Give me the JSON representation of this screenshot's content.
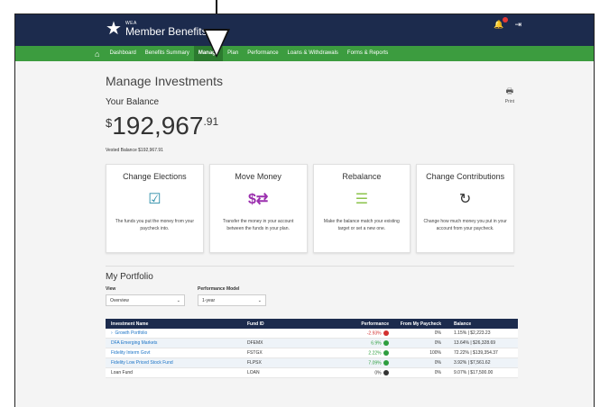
{
  "header": {
    "logo_small": "WEA",
    "logo_big": "Member Benefits",
    "bell_icon": "bell-icon",
    "logout_icon": "logout-icon"
  },
  "nav": {
    "items": [
      "Dashboard",
      "Benefits Summary",
      "Manage",
      "Plan",
      "Performance",
      "Loans & Withdrawals",
      "Forms & Reports"
    ],
    "active": "Manage"
  },
  "page": {
    "title": "Manage Investments",
    "print_label": "Print",
    "balance_label": "Your Balance",
    "balance_dollar": "$",
    "balance_main": "192,967",
    "balance_cents": ".91",
    "vested": "Vested Balance $192,967.91"
  },
  "cards": [
    {
      "title": "Change Elections",
      "icon": "✅",
      "desc": "The funds you put the money from your paycheck into.",
      "color": "#2a8ca8"
    },
    {
      "title": "Move Money",
      "icon": "$⇄",
      "desc": "Transfer the money in your account between the funds in your plan.",
      "color": "#9b2fae"
    },
    {
      "title": "Rebalance",
      "icon": "☰",
      "desc": "Make the balance match your existing target or set a new one.",
      "color": "#8bc34a"
    },
    {
      "title": "Change Contributions",
      "icon": "↻",
      "desc": "Change how much money you put in your account from your paycheck.",
      "color": "#333333"
    }
  ],
  "portfolio": {
    "title": "My Portfolio",
    "view_label": "View",
    "view_value": "Overview",
    "model_label": "Performance Model",
    "model_value": "1-year",
    "columns": [
      "Investment Name",
      "Fund ID",
      "Performance",
      "From My Paycheck",
      "Balance"
    ],
    "rows": [
      {
        "name": "Growth Portfolio",
        "fund": "",
        "perf": "-2.93%",
        "paycheck": "0%",
        "balance": "1.15%  |  $2,223.23"
      },
      {
        "name": "DFA Emerging Markets",
        "fund": "DFEMX",
        "perf": "6.9%",
        "paycheck": "0%",
        "balance": "13.64%  |  $26,328.69"
      },
      {
        "name": "Fidelity Interm Govt",
        "fund": "FSTGX",
        "perf": "2.22%",
        "paycheck": "100%",
        "balance": "72.22%  |  $139,354.37"
      },
      {
        "name": "Fidelity Low Priced Stock Fund",
        "fund": "FLPSX",
        "perf": "7.09%",
        "paycheck": "0%",
        "balance": "3.92%  |  $7,561.62"
      },
      {
        "name": "Loan Fund",
        "fund": "LOAN",
        "perf": "0%",
        "paycheck": "0%",
        "balance": "9.07%  |  $17,500.00"
      }
    ]
  },
  "colors": {
    "topbar": "#1c2b4d",
    "nav": "#3c9c3f",
    "nav_active": "#2c7a2f",
    "link": "#1a73c6"
  }
}
